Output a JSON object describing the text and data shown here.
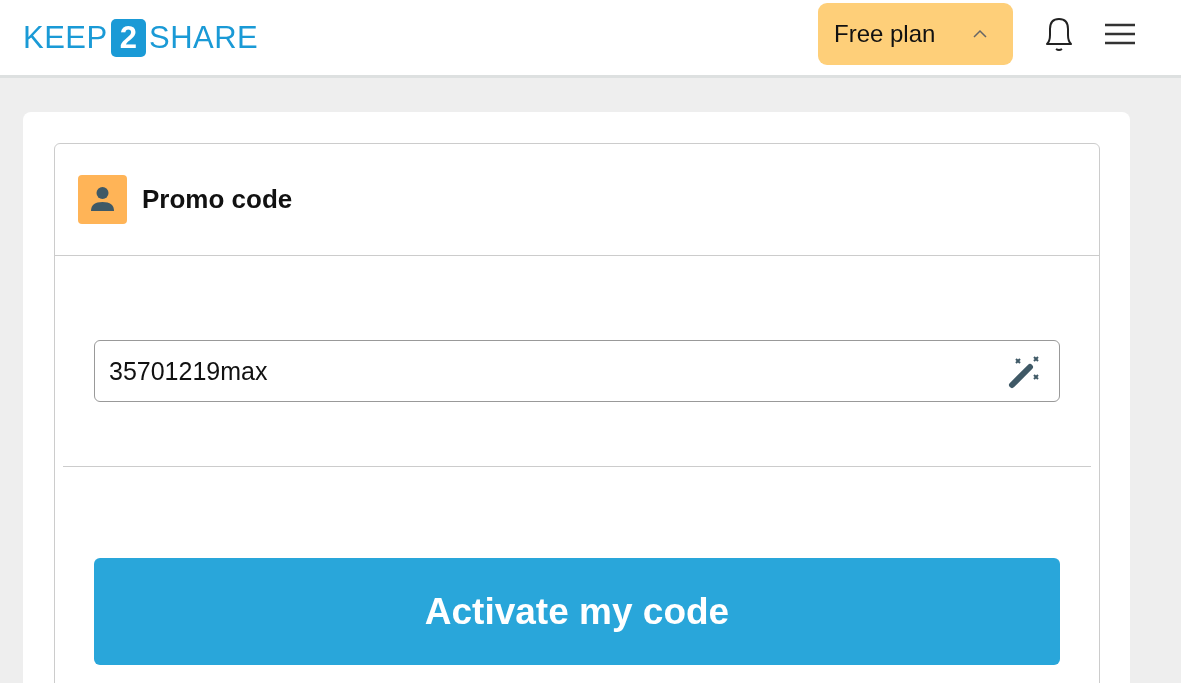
{
  "header": {
    "logo": [
      "KEEP",
      "2",
      "SHARE"
    ],
    "plan_button": {
      "label": "Free plan",
      "expanded": true
    }
  },
  "panel": {
    "title": "Promo code",
    "promo_field": {
      "value": "35701219max"
    },
    "submit_button": "Activate my code"
  }
}
